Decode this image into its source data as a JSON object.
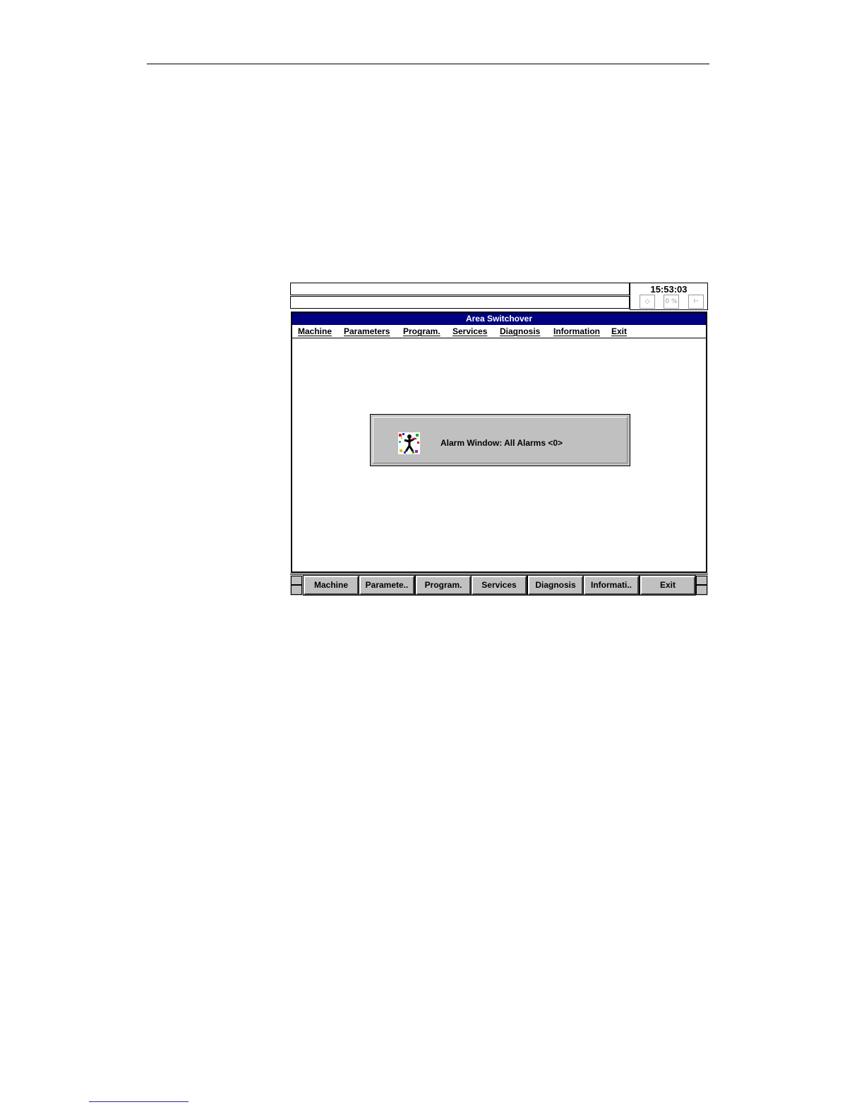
{
  "status": {
    "line1": "",
    "line2": "",
    "time": "15:53:03",
    "indicator_icons": [
      "cycle-icon",
      "override-percent-icon",
      "exit-door-icon"
    ],
    "override_text": "0 %"
  },
  "window": {
    "title": "Area Switchover",
    "title_bar_color": "#000080"
  },
  "menu": {
    "items": [
      {
        "label": "Machine"
      },
      {
        "label": "Parameters"
      },
      {
        "label": "Program."
      },
      {
        "label": "Services"
      },
      {
        "label": "Diagnosis"
      },
      {
        "label": "Information"
      },
      {
        "label": "Exit"
      }
    ]
  },
  "alarm": {
    "text": "Alarm Window: All Alarms <0>",
    "icon": "alarm-person-icon"
  },
  "softkeys": [
    {
      "label": "Machine"
    },
    {
      "label": "Paramete.."
    },
    {
      "label": "Program."
    },
    {
      "label": "Services"
    },
    {
      "label": "Diagnosis"
    },
    {
      "label": "Informati.."
    },
    {
      "label": "Exit"
    }
  ]
}
